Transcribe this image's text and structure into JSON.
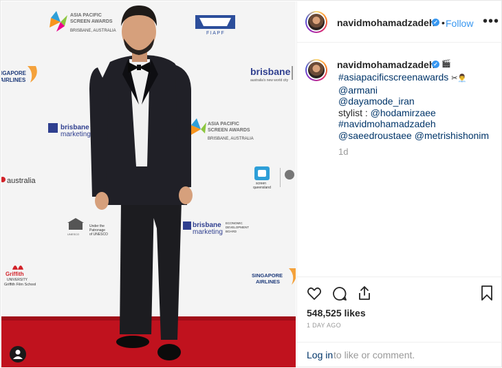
{
  "post": {
    "username": "navidmohamadzadeh",
    "header_separator": "•",
    "follow_label": "Follow",
    "more_label": "•••",
    "caption_lines": [
      {
        "text": "#asiapacificscreenawards",
        "kind": "link"
      },
      {
        "text": "@armani",
        "kind": "link"
      },
      {
        "text": "@dayamode_iran",
        "kind": "link"
      },
      {
        "text": "stylist : ",
        "kind": "text",
        "link": "@hodamirzaee"
      },
      {
        "text": "#navidmohamadzadeh",
        "kind": "link"
      },
      {
        "text": "@saeedroustaee",
        "kind": "link",
        "link2": "@metrishishonim"
      }
    ],
    "caption_emoji_1": "🎬",
    "caption_emoji_2": "✂👨‍💼",
    "posted_ago": "1d",
    "likes": "548,525 likes",
    "date": "1 DAY AGO",
    "login_link": "Log in",
    "login_rest": "to like or comment."
  },
  "backdrop": {
    "apsa_line1": "ASIA PACIFIC",
    "apsa_line2": "SCREEN AWARDS",
    "apsa_line3": "BRISBANE, AUSTRALIA",
    "fiapf": "FIAPF",
    "brisbane": "brisbane",
    "brisbane_tag": "australia's new world city",
    "brisbane_marketing": "marketing",
    "singapore_1": "SINGAPORE",
    "singapore_2": "AIRLINES",
    "australia": "australia",
    "screen_queensland_1": "screen",
    "screen_queensland_2": "queensland",
    "unesco_1": "Under the",
    "unesco_2": "Patronage",
    "unesco_3": "of UNESCO",
    "unesco_name": "UNESCO",
    "griffith_1": "Griffith",
    "griffith_2": "UNIVERSITY",
    "griffith_3": "Griffith Film School",
    "edb_1": "ECONOMIC",
    "edb_2": "DEVELOPMENT",
    "edb_3": "BOARD"
  },
  "colors": {
    "link": "#003569",
    "verified": "#3897f0",
    "follow": "#3897f0",
    "carpet": "#c0121e",
    "brisbane_blue": "#2f3f8f"
  }
}
